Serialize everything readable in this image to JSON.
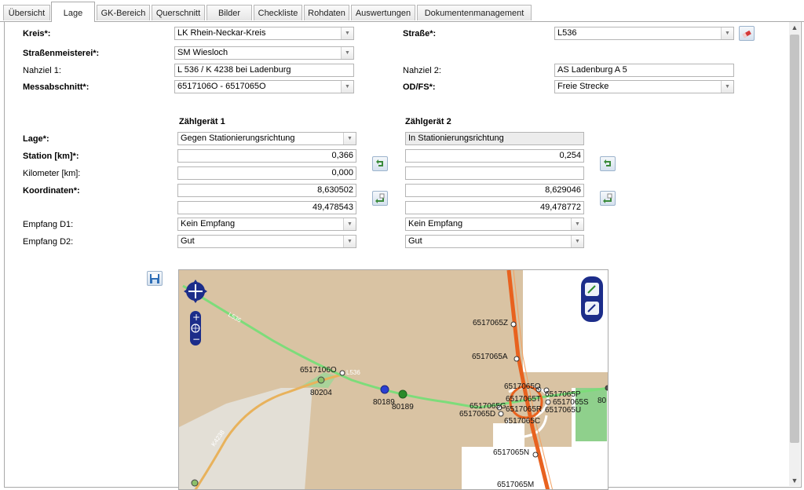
{
  "tabs": [
    "Übersicht",
    "Lage",
    "GK-Bereich",
    "Querschnitt",
    "Bilder",
    "Checkliste",
    "Rohdaten",
    "Auswertungen",
    "Dokumentenmanagement"
  ],
  "active_tab": "Lage",
  "form": {
    "kreis_label": "Kreis*:",
    "kreis_value": "LK Rhein-Neckar-Kreis",
    "strasse_label": "Straße*:",
    "strasse_value": "L536",
    "meisterei_label": "Straßenmeisterei*:",
    "meisterei_value": "SM Wiesloch",
    "nahziel1_label": "Nahziel 1:",
    "nahziel1_value": "L 536 / K 4238 bei Ladenburg",
    "nahziel2_label": "Nahziel 2:",
    "nahziel2_value": "AS Ladenburg A 5",
    "messabschnitt_label": "Messabschnitt*:",
    "messabschnitt_value": "6517106O - 6517065O",
    "odfs_label": "OD/FS*:",
    "odfs_value": "Freie Strecke"
  },
  "devices": {
    "header1": "Zählgerät 1",
    "header2": "Zählgerät 2",
    "lage_label": "Lage*:",
    "station_label": "Station [km]*:",
    "kilometer_label": "Kilometer [km]:",
    "koordinaten_label": "Koordinaten*:",
    "empfang1_label": "Empfang D1:",
    "empfang2_label": "Empfang D2:",
    "d1": {
      "lage": "Gegen Stationierungsrichtung",
      "station": "0,366",
      "kilometer": "0,000",
      "x": "8,630502",
      "y": "49,478543",
      "empfang1": "Kein Empfang",
      "empfang2": "Gut"
    },
    "d2": {
      "lage": "In Stationierungsrichtung",
      "station": "0,254",
      "kilometer": "",
      "x": "8,629046",
      "y": "49,478772",
      "empfang1": "Kein Empfang",
      "empfang2": "Gut"
    }
  },
  "map": {
    "road_labels": [
      "L536",
      "L536",
      "K4238"
    ],
    "points": [
      "6517065Z",
      "6517065A",
      "6517106O",
      "80204",
      "80189",
      "80189",
      "6517065G",
      "6517065D",
      "6517065Q",
      "6517065T",
      "6517065R",
      "6517065P",
      "6517065S",
      "6517065U",
      "6517065C",
      "6517065N",
      "6517065M",
      "80"
    ]
  },
  "colors": {
    "accent": "#1f4fa0",
    "road_green": "#7ddc7a",
    "road_orange": "#e8b25c",
    "motorway": "#e8621f"
  },
  "icons": [
    "pan-arrows-icon",
    "zoom-in-icon",
    "globe-icon",
    "zoom-out-icon",
    "edit-pen-icon",
    "edit-pen-alt-icon",
    "eraser-icon",
    "swap-icon",
    "swap-icon",
    "copy-icon",
    "copy-icon",
    "save-icon"
  ]
}
